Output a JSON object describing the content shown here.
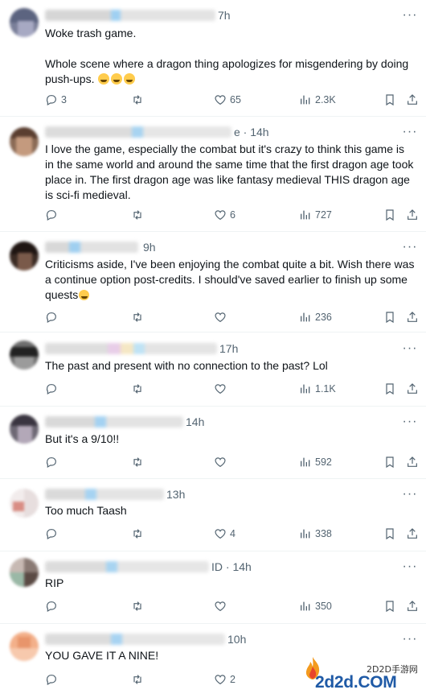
{
  "tweets": [
    {
      "time": "7h",
      "text": "Woke trash game.\n\nWhole scene where a dragon thing apologizes for misgendering by doing push-ups.",
      "emoji": "🤣🤣🤣",
      "replies": "3",
      "reposts": "",
      "likes": "65",
      "views": "2.3K"
    },
    {
      "time": "e · 14h",
      "text": "I love the game, especially the combat but it's crazy to think this game is in the same world and around the same time that the first dragon age took place in. The first dragon age was like fantasy medieval THIS dragon age is sci-fi medieval.",
      "replies": "",
      "reposts": "",
      "likes": "6",
      "views": "727"
    },
    {
      "time": "9h",
      "text": "Criticisms aside, I've been enjoying the combat quite a bit. Wish there was a continue option post-credits. I should've saved earlier to finish up some quests",
      "emoji": "😢",
      "replies": "",
      "reposts": "",
      "likes": "",
      "views": "236"
    },
    {
      "time": "17h",
      "text": "The past and present with no connection to the past? Lol",
      "replies": "",
      "reposts": "",
      "likes": "",
      "views": "1.1K"
    },
    {
      "time": "14h",
      "text": "But it's a 9/10!!",
      "replies": "",
      "reposts": "",
      "likes": "",
      "views": "592"
    },
    {
      "time": "13h",
      "text": "Too much Taash",
      "replies": "",
      "reposts": "",
      "likes": "4",
      "views": "338"
    },
    {
      "time": "ID · 14h",
      "text": "RIP",
      "replies": "",
      "reposts": "",
      "likes": "",
      "views": "350"
    },
    {
      "time": "10h",
      "text": "YOU GAVE IT A NINE!",
      "replies": "",
      "reposts": "",
      "likes": "2",
      "views": ""
    }
  ],
  "watermark": {
    "small": "2D2D手游网",
    "big": "2d2d.COM"
  },
  "colors": {
    "text": "#0f1419",
    "muted": "#536471",
    "divider": "#eff3f4",
    "watermark": "#1f5aa6"
  }
}
